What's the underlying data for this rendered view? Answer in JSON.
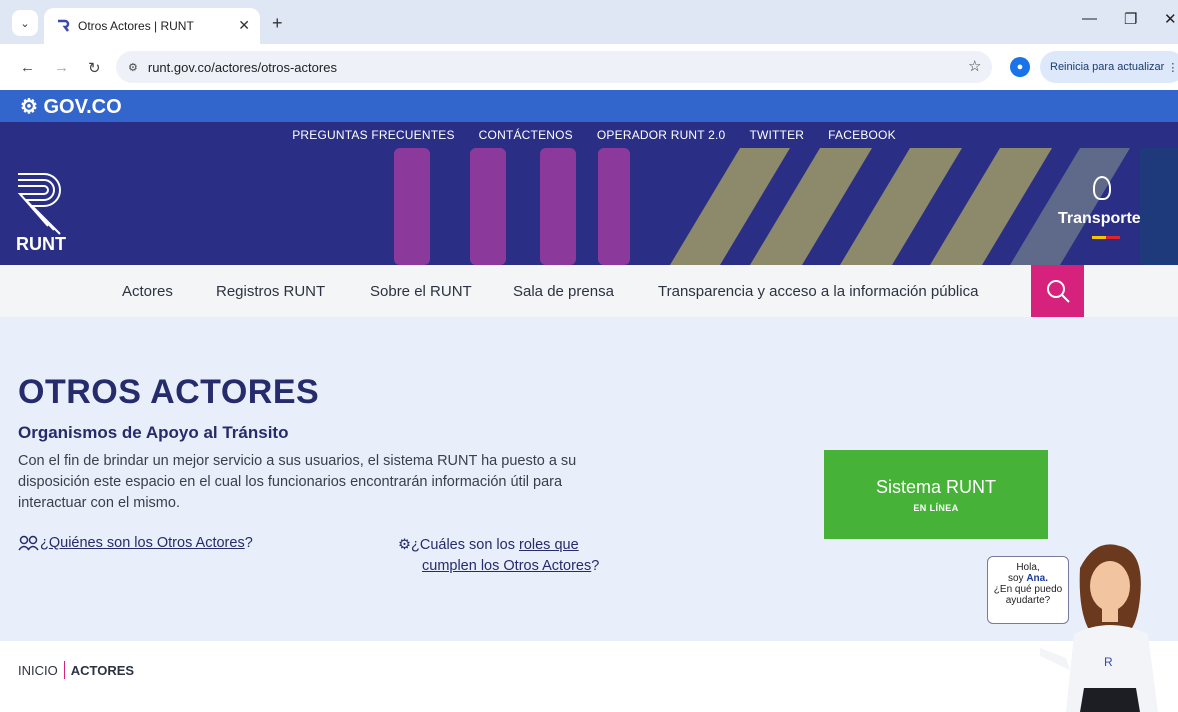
{
  "browser": {
    "tab_title": "Otros Actores | RUNT",
    "url": "runt.gov.co/actores/otros-actores",
    "update_button": "Reinicia para actualizar"
  },
  "gov_logo": "GOV.CO",
  "top_links": [
    "PREGUNTAS FRECUENTES",
    "CONTÁCTENOS",
    "OPERADOR RUNT 2.0",
    "TWITTER",
    "FACEBOOK"
  ],
  "banner": {
    "logo_text": "RUNT",
    "ministry": "Transporte"
  },
  "nav": {
    "items": [
      "Actores",
      "Registros RUNT",
      "Sobre el RUNT",
      "Sala de prensa",
      "Transparencia y acceso a la información pública"
    ]
  },
  "main": {
    "title": "OTROS ACTORES",
    "subtitle": "Organismos de Apoyo al Tránsito",
    "intro": "Con el fin de brindar un mejor servicio a sus usuarios, el sistema RUNT ha puesto a su disposición este espacio en el cual los funcionarios encontrarán información útil para interactuar con el mismo.",
    "q1_prefix": "¿",
    "q1_link": "Quiénes son los Otros Actores",
    "q1_suffix": "?",
    "q2_prefix": "¿Cuáles son los ",
    "q2_link_1": "roles que",
    "q2_link_2": "cumplen los Otros Actores",
    "q2_suffix": "?",
    "runt_button": {
      "title": "Sistema RUNT",
      "subtitle": "EN LÍNEA"
    }
  },
  "breadcrumb": {
    "home": "INICIO",
    "current": "ACTORES"
  },
  "assistant": {
    "line1": "Hola,",
    "line2_prefix": "soy ",
    "name": "Ana.",
    "line3": "¿En qué puedo",
    "line4": "ayudarte?"
  },
  "colors": {
    "primary": "#2a2f85",
    "accent": "#d6227c",
    "green": "#46b338",
    "gov": "#3366cc"
  }
}
